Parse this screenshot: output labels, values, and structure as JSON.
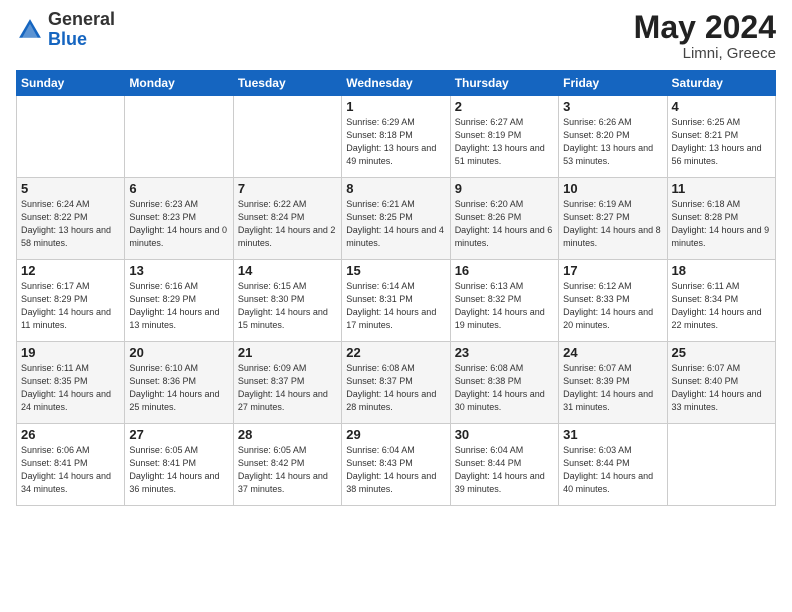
{
  "logo": {
    "general": "General",
    "blue": "Blue"
  },
  "header": {
    "month_year": "May 2024",
    "location": "Limni, Greece"
  },
  "weekdays": [
    "Sunday",
    "Monday",
    "Tuesday",
    "Wednesday",
    "Thursday",
    "Friday",
    "Saturday"
  ],
  "weeks": [
    [
      {
        "day": "",
        "sunrise": "",
        "sunset": "",
        "daylight": ""
      },
      {
        "day": "",
        "sunrise": "",
        "sunset": "",
        "daylight": ""
      },
      {
        "day": "",
        "sunrise": "",
        "sunset": "",
        "daylight": ""
      },
      {
        "day": "1",
        "sunrise": "Sunrise: 6:29 AM",
        "sunset": "Sunset: 8:18 PM",
        "daylight": "Daylight: 13 hours and 49 minutes."
      },
      {
        "day": "2",
        "sunrise": "Sunrise: 6:27 AM",
        "sunset": "Sunset: 8:19 PM",
        "daylight": "Daylight: 13 hours and 51 minutes."
      },
      {
        "day": "3",
        "sunrise": "Sunrise: 6:26 AM",
        "sunset": "Sunset: 8:20 PM",
        "daylight": "Daylight: 13 hours and 53 minutes."
      },
      {
        "day": "4",
        "sunrise": "Sunrise: 6:25 AM",
        "sunset": "Sunset: 8:21 PM",
        "daylight": "Daylight: 13 hours and 56 minutes."
      }
    ],
    [
      {
        "day": "5",
        "sunrise": "Sunrise: 6:24 AM",
        "sunset": "Sunset: 8:22 PM",
        "daylight": "Daylight: 13 hours and 58 minutes."
      },
      {
        "day": "6",
        "sunrise": "Sunrise: 6:23 AM",
        "sunset": "Sunset: 8:23 PM",
        "daylight": "Daylight: 14 hours and 0 minutes."
      },
      {
        "day": "7",
        "sunrise": "Sunrise: 6:22 AM",
        "sunset": "Sunset: 8:24 PM",
        "daylight": "Daylight: 14 hours and 2 minutes."
      },
      {
        "day": "8",
        "sunrise": "Sunrise: 6:21 AM",
        "sunset": "Sunset: 8:25 PM",
        "daylight": "Daylight: 14 hours and 4 minutes."
      },
      {
        "day": "9",
        "sunrise": "Sunrise: 6:20 AM",
        "sunset": "Sunset: 8:26 PM",
        "daylight": "Daylight: 14 hours and 6 minutes."
      },
      {
        "day": "10",
        "sunrise": "Sunrise: 6:19 AM",
        "sunset": "Sunset: 8:27 PM",
        "daylight": "Daylight: 14 hours and 8 minutes."
      },
      {
        "day": "11",
        "sunrise": "Sunrise: 6:18 AM",
        "sunset": "Sunset: 8:28 PM",
        "daylight": "Daylight: 14 hours and 9 minutes."
      }
    ],
    [
      {
        "day": "12",
        "sunrise": "Sunrise: 6:17 AM",
        "sunset": "Sunset: 8:29 PM",
        "daylight": "Daylight: 14 hours and 11 minutes."
      },
      {
        "day": "13",
        "sunrise": "Sunrise: 6:16 AM",
        "sunset": "Sunset: 8:29 PM",
        "daylight": "Daylight: 14 hours and 13 minutes."
      },
      {
        "day": "14",
        "sunrise": "Sunrise: 6:15 AM",
        "sunset": "Sunset: 8:30 PM",
        "daylight": "Daylight: 14 hours and 15 minutes."
      },
      {
        "day": "15",
        "sunrise": "Sunrise: 6:14 AM",
        "sunset": "Sunset: 8:31 PM",
        "daylight": "Daylight: 14 hours and 17 minutes."
      },
      {
        "day": "16",
        "sunrise": "Sunrise: 6:13 AM",
        "sunset": "Sunset: 8:32 PM",
        "daylight": "Daylight: 14 hours and 19 minutes."
      },
      {
        "day": "17",
        "sunrise": "Sunrise: 6:12 AM",
        "sunset": "Sunset: 8:33 PM",
        "daylight": "Daylight: 14 hours and 20 minutes."
      },
      {
        "day": "18",
        "sunrise": "Sunrise: 6:11 AM",
        "sunset": "Sunset: 8:34 PM",
        "daylight": "Daylight: 14 hours and 22 minutes."
      }
    ],
    [
      {
        "day": "19",
        "sunrise": "Sunrise: 6:11 AM",
        "sunset": "Sunset: 8:35 PM",
        "daylight": "Daylight: 14 hours and 24 minutes."
      },
      {
        "day": "20",
        "sunrise": "Sunrise: 6:10 AM",
        "sunset": "Sunset: 8:36 PM",
        "daylight": "Daylight: 14 hours and 25 minutes."
      },
      {
        "day": "21",
        "sunrise": "Sunrise: 6:09 AM",
        "sunset": "Sunset: 8:37 PM",
        "daylight": "Daylight: 14 hours and 27 minutes."
      },
      {
        "day": "22",
        "sunrise": "Sunrise: 6:08 AM",
        "sunset": "Sunset: 8:37 PM",
        "daylight": "Daylight: 14 hours and 28 minutes."
      },
      {
        "day": "23",
        "sunrise": "Sunrise: 6:08 AM",
        "sunset": "Sunset: 8:38 PM",
        "daylight": "Daylight: 14 hours and 30 minutes."
      },
      {
        "day": "24",
        "sunrise": "Sunrise: 6:07 AM",
        "sunset": "Sunset: 8:39 PM",
        "daylight": "Daylight: 14 hours and 31 minutes."
      },
      {
        "day": "25",
        "sunrise": "Sunrise: 6:07 AM",
        "sunset": "Sunset: 8:40 PM",
        "daylight": "Daylight: 14 hours and 33 minutes."
      }
    ],
    [
      {
        "day": "26",
        "sunrise": "Sunrise: 6:06 AM",
        "sunset": "Sunset: 8:41 PM",
        "daylight": "Daylight: 14 hours and 34 minutes."
      },
      {
        "day": "27",
        "sunrise": "Sunrise: 6:05 AM",
        "sunset": "Sunset: 8:41 PM",
        "daylight": "Daylight: 14 hours and 36 minutes."
      },
      {
        "day": "28",
        "sunrise": "Sunrise: 6:05 AM",
        "sunset": "Sunset: 8:42 PM",
        "daylight": "Daylight: 14 hours and 37 minutes."
      },
      {
        "day": "29",
        "sunrise": "Sunrise: 6:04 AM",
        "sunset": "Sunset: 8:43 PM",
        "daylight": "Daylight: 14 hours and 38 minutes."
      },
      {
        "day": "30",
        "sunrise": "Sunrise: 6:04 AM",
        "sunset": "Sunset: 8:44 PM",
        "daylight": "Daylight: 14 hours and 39 minutes."
      },
      {
        "day": "31",
        "sunrise": "Sunrise: 6:03 AM",
        "sunset": "Sunset: 8:44 PM",
        "daylight": "Daylight: 14 hours and 40 minutes."
      },
      {
        "day": "",
        "sunrise": "",
        "sunset": "",
        "daylight": ""
      }
    ]
  ]
}
